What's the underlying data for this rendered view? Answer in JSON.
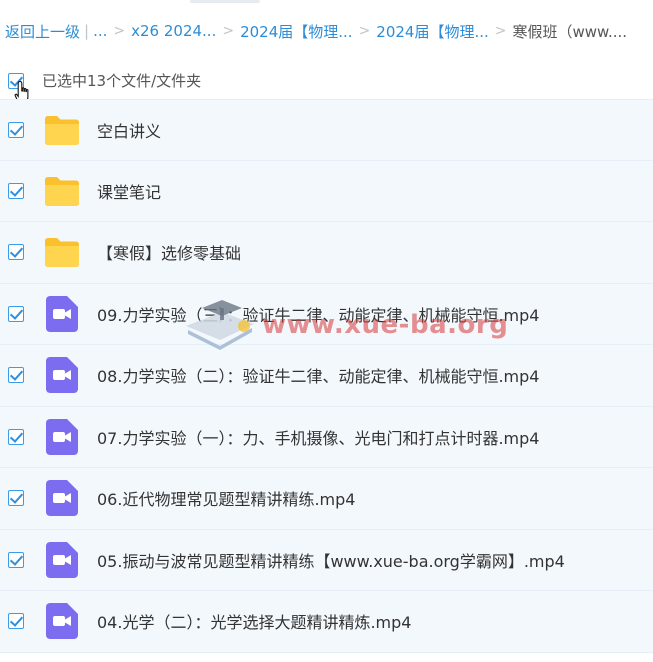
{
  "breadcrumb": {
    "back": "返回上一级",
    "ellipsis": "...",
    "items": [
      "x26 2024...",
      "2024届【物理...",
      "2024届【物理..."
    ],
    "current": "寒假班（www...."
  },
  "selection": {
    "label": "已选中13个文件/文件夹"
  },
  "files": [
    {
      "name": "空白讲义",
      "type": "folder",
      "checked": true
    },
    {
      "name": "课堂笔记",
      "type": "folder",
      "checked": true
    },
    {
      "name": "【寒假】选修零基础",
      "type": "folder",
      "checked": true
    },
    {
      "name": "09.力学实验（三）：验证牛二律、动能定律、机械能守恒.mp4",
      "type": "video",
      "checked": true
    },
    {
      "name": "08.力学实验（二）：验证牛二律、动能定律、机械能守恒.mp4",
      "type": "video",
      "checked": true
    },
    {
      "name": "07.力学实验（一）：力、手机摄像、光电门和打点计时器.mp4",
      "type": "video",
      "checked": true
    },
    {
      "name": "06.近代物理常见题型精讲精练.mp4",
      "type": "video",
      "checked": true
    },
    {
      "name": "05.振动与波常见题型精讲精练【www.xue-ba.org学霸网】.mp4",
      "type": "video",
      "checked": true
    },
    {
      "name": "04.光学（二）：光学选择大题精讲精炼.mp4",
      "type": "video",
      "checked": true
    }
  ],
  "watermark": {
    "text": "www.xue-ba.org"
  },
  "colors": {
    "accent": "#2c8dd6",
    "folder": "#fcd34d",
    "video": "#7b6cf0",
    "row_bg": "#f3f8fd"
  }
}
